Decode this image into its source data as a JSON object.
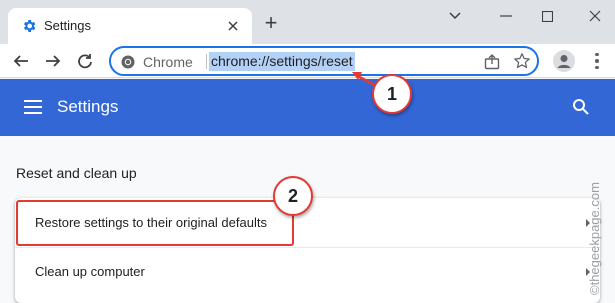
{
  "browser": {
    "tab": {
      "title": "Settings",
      "close_icon": "close-icon"
    },
    "new_tab_symbol": "+",
    "toolbar": {
      "site_label": "Chrome",
      "url": "chrome://settings/reset"
    }
  },
  "settings": {
    "header_title": "Settings",
    "section_title": "Reset and clean up",
    "rows": [
      {
        "label": "Restore settings to their original defaults"
      },
      {
        "label": "Clean up computer"
      }
    ]
  },
  "annotations": {
    "marker_1": "1",
    "marker_2": "2"
  },
  "watermark": "©thegeekpage.com",
  "colors": {
    "header": "#3367d6",
    "accent": "#1a73e8",
    "annotation_red": "#e53935"
  }
}
